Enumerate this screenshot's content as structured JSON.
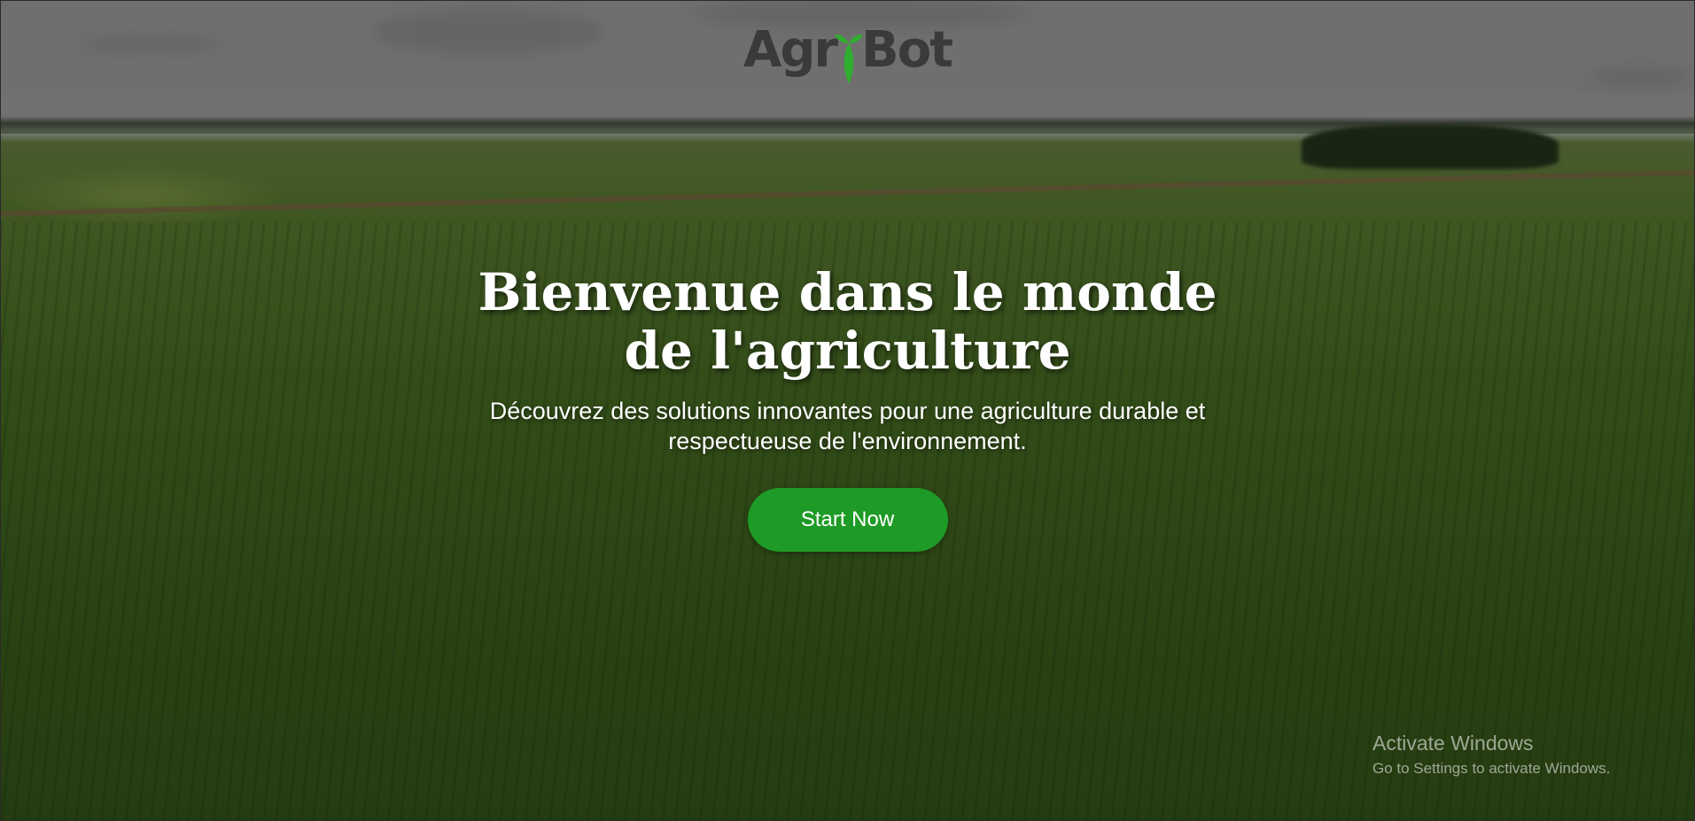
{
  "brand": {
    "logo_left": "Agr",
    "logo_right": "Bot",
    "logo_text_color": "#3a3a3a",
    "leaf_color": "#2fae2f"
  },
  "hero": {
    "title": "Bienvenue dans le monde de l'agriculture",
    "subtitle": "Découvrez des solutions innovantes pour une agriculture durable et respectueuse de l'environnement.",
    "cta_label": "Start Now",
    "cta_color": "#1e9b26"
  },
  "os_watermark": {
    "title": "Activate Windows",
    "subtitle": "Go to Settings to activate Windows."
  }
}
